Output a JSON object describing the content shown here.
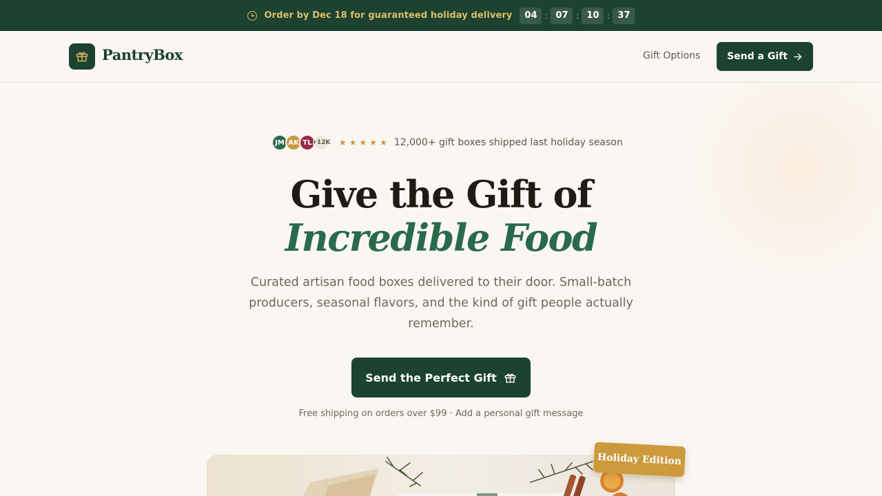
{
  "announcement": {
    "text": "Order by Dec 18 for guaranteed holiday delivery",
    "countdown": [
      "04",
      "07",
      "10",
      "37"
    ],
    "separator": ":"
  },
  "nav": {
    "brand": "PantryBox",
    "link": "Gift Options",
    "cta": "Send a Gift"
  },
  "proof": {
    "avatars": [
      {
        "initials": "JM",
        "color": "#2a6a4c"
      },
      {
        "initials": "AK",
        "color": "#c8993e"
      },
      {
        "initials": "TL",
        "color": "#9a2a4a"
      },
      {
        "initials": "+12K",
        "color": "#ede7dc"
      }
    ],
    "stars": 5,
    "text": "12,000+ gift boxes shipped last holiday season"
  },
  "hero": {
    "title_line1": "Give the Gift of",
    "title_line2": "Incredible Food",
    "subtitle": "Curated artisan food boxes delivered to their door. Small-batch producers, seasonal flavors, and the kind of gift people actually remember.",
    "cta": "Send the Perfect Gift",
    "shipping_note": "Free shipping on orders over $99 · Add a personal gift message"
  },
  "product": {
    "badge": "Holiday Edition"
  },
  "colors": {
    "brand": "#1c4230",
    "accent_gold": "#c8993e",
    "accent_green": "#2a6a4c",
    "background": "#faf7f2"
  }
}
